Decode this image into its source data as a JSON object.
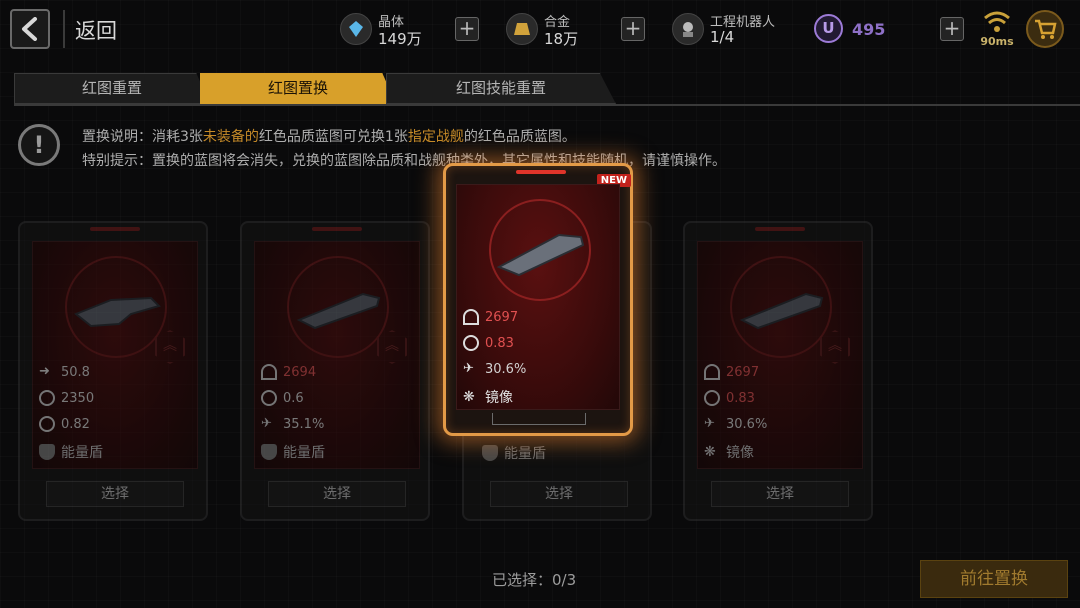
{
  "header": {
    "back_label": "返回",
    "resources": [
      {
        "name": "晶体",
        "value": "149万"
      },
      {
        "name": "合金",
        "value": "18万"
      },
      {
        "name": "工程机器人",
        "value": "1/4"
      }
    ],
    "u_label": "U",
    "u_value": "495",
    "ping": "90ms"
  },
  "tabs": [
    {
      "label": "红图重置",
      "active": false
    },
    {
      "label": "红图置换",
      "active": true
    },
    {
      "label": "红图技能重置",
      "active": false
    }
  ],
  "notice": {
    "line1_a": "置换说明：消耗3张",
    "line1_b": "未装备的",
    "line1_c": "红色品质蓝图可兑换1张",
    "line1_d": "指定战舰",
    "line1_e": "的红色品质蓝图。",
    "line2": "特别提示：置换的蓝图将会消失，兑换的蓝图除品质和战舰种类外，其它属性和技能随机，请谨慎操作。"
  },
  "cards": [
    {
      "stat1": "50.8",
      "stat2": "2350",
      "stat3": "0.82",
      "skill": "能量盾",
      "select": "选择"
    },
    {
      "stat1": "2694",
      "stat2": "0.6",
      "stat3": "35.1%",
      "skill": "能量盾",
      "select": "选择"
    },
    {
      "stat1": "2697",
      "stat2": "0.83",
      "stat3": "30.6%",
      "skill": "镜像",
      "select": "选择",
      "badge": "NEW",
      "behind_skill": "能量盾"
    },
    {
      "stat1": "2697",
      "stat2": "0.83",
      "stat3": "30.6%",
      "skill": "镜像",
      "select": "选择"
    }
  ],
  "footer": {
    "selected": "已选择：0/3",
    "go_button": "前往置换"
  },
  "colors": {
    "accent": "#d8a02a",
    "red_stat": "#e05050",
    "highlight": "#c58a28"
  }
}
